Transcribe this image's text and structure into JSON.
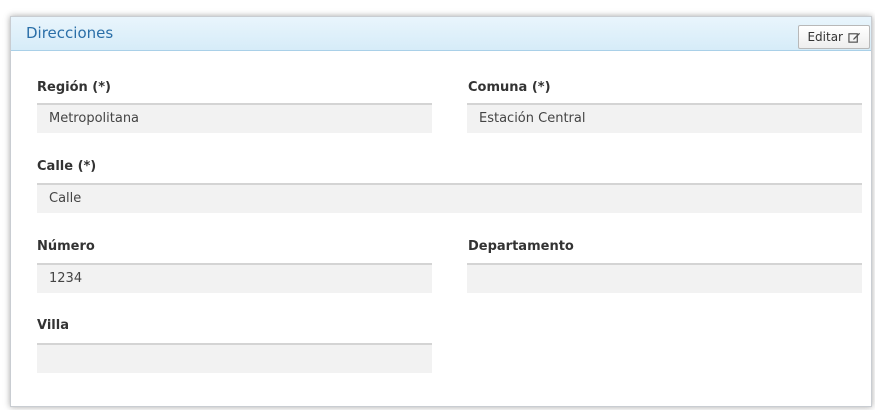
{
  "panel": {
    "title": "Direcciones",
    "edit_label": "Editar"
  },
  "fields": {
    "region": {
      "label": "Región (*)",
      "value": "Metropolitana"
    },
    "comuna": {
      "label": "Comuna (*)",
      "value": "Estación Central"
    },
    "calle": {
      "label": "Calle (*)",
      "value": "Calle"
    },
    "numero": {
      "label": "Número",
      "value": "1234"
    },
    "departamento": {
      "label": "Departamento",
      "value": ""
    },
    "villa": {
      "label": "Villa",
      "value": ""
    }
  },
  "colors": {
    "header_bg": "#d6ecf8",
    "title_text": "#2a6fa8",
    "field_bg": "#f2f2f2"
  },
  "icons": {
    "edit": "edit-icon"
  }
}
